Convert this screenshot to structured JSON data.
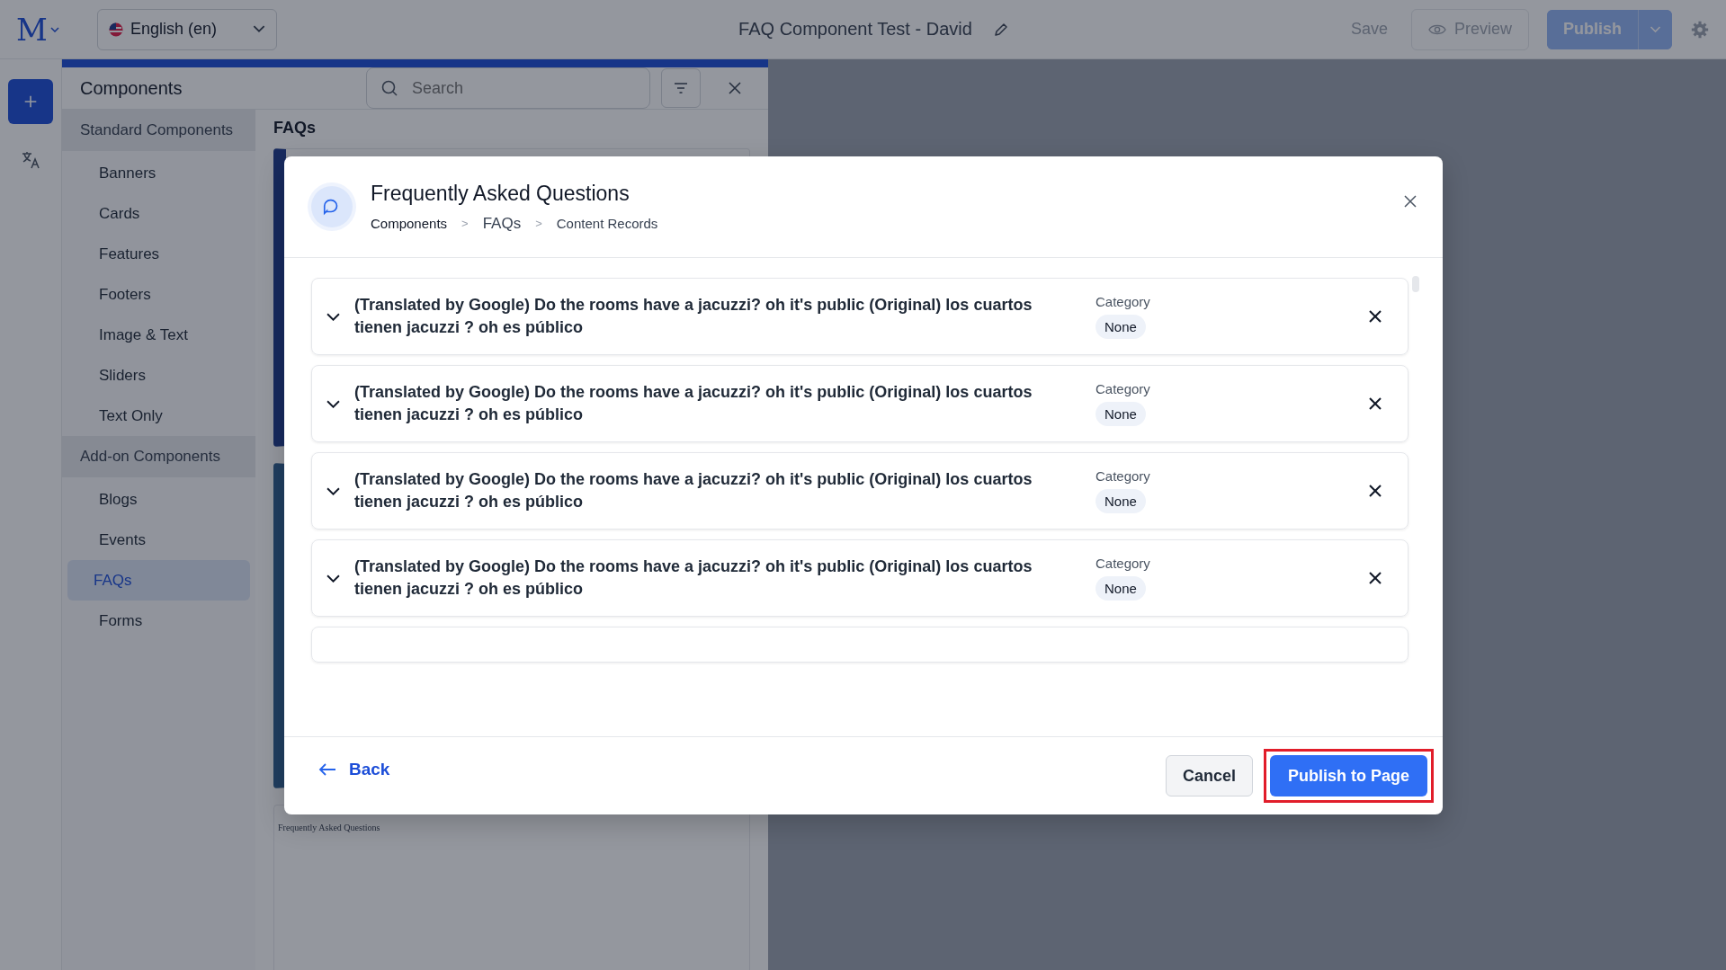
{
  "topbar": {
    "logo": "M",
    "language": "English (en)",
    "title": "FAQ Component Test - David",
    "save": "Save",
    "preview": "Preview",
    "publish": "Publish"
  },
  "panel": {
    "title": "Components",
    "search_placeholder": "Search",
    "groups": [
      {
        "label": "Standard Components",
        "items": [
          {
            "label": "Banners",
            "selected": false
          },
          {
            "label": "Cards",
            "selected": false
          },
          {
            "label": "Features",
            "selected": false
          },
          {
            "label": "Footers",
            "selected": false
          },
          {
            "label": "Image & Text",
            "selected": false
          },
          {
            "label": "Sliders",
            "selected": false
          },
          {
            "label": "Text Only",
            "selected": false
          }
        ]
      },
      {
        "label": "Add-on Components",
        "items": [
          {
            "label": "Blogs",
            "selected": false
          },
          {
            "label": "Events",
            "selected": false
          },
          {
            "label": "FAQs",
            "selected": true
          },
          {
            "label": "Forms",
            "selected": false
          }
        ]
      }
    ],
    "section_title": "FAQs",
    "preview_caption": "Frequently Asked Questions"
  },
  "modal": {
    "title": "Frequently Asked Questions",
    "breadcrumb": [
      {
        "kind": "link",
        "text": "Components"
      },
      {
        "kind": "separator",
        "text": ">"
      },
      {
        "kind": "current",
        "text": "FAQs"
      },
      {
        "kind": "separator",
        "text": ">"
      },
      {
        "kind": "link",
        "text": "Content Records"
      }
    ],
    "records": [
      {
        "question": "(Translated by Google) Do the rooms have a jacuzzi? oh it's public (Original) los cuartos tienen jacuzzi ? oh es público",
        "category_label": "Category",
        "category": "None"
      },
      {
        "question": "(Translated by Google) Do the rooms have a jacuzzi? oh it's public (Original) los cuartos tienen jacuzzi ? oh es público",
        "category_label": "Category",
        "category": "None"
      },
      {
        "question": "(Translated by Google) Do the rooms have a jacuzzi? oh it's public (Original) los cuartos tienen jacuzzi ? oh es público",
        "category_label": "Category",
        "category": "None"
      },
      {
        "question": "(Translated by Google) Do the rooms have a jacuzzi? oh it's public (Original) los cuartos tienen jacuzzi ? oh es público",
        "category_label": "Category",
        "category": "None"
      }
    ],
    "back": "Back",
    "cancel": "Cancel",
    "publish": {
      "label": "Publish to Page",
      "highlighted": true
    }
  }
}
